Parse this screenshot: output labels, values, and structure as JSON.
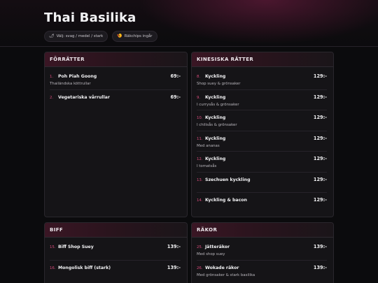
{
  "header": {
    "title": "Thai Basilika",
    "chips": [
      {
        "icon": "🌶",
        "icon_name": "chili-icon",
        "label": "Välj: svag / medel / stark"
      },
      {
        "icon": "🍤",
        "icon_name": "shrimp-chips-icon",
        "label": "Räkchips ingår"
      }
    ]
  },
  "colors": {
    "accent": "#d94b7c",
    "background": "#0b0b0d",
    "card": "#151417"
  },
  "sections": [
    {
      "title": "FÖRRÄTTER",
      "items": [
        {
          "num": "1.",
          "name": "Poh Piah Goong",
          "price": "69:-",
          "desc": "Thailändska köttrullar"
        },
        {
          "num": "2.",
          "name": "Vegetariska vårrullar",
          "price": "69:-",
          "desc": ""
        }
      ]
    },
    {
      "title": "KINESISKA RÄTTER",
      "items": [
        {
          "num": "8.",
          "name": "Kyckling",
          "price": "129:-",
          "desc": "Shop suey & grönsaker"
        },
        {
          "num": "9.",
          "name": "Kyckling",
          "price": "129:-",
          "desc": "I currysås & grönsaker"
        },
        {
          "num": "10.",
          "name": "Kyckling",
          "price": "129:-",
          "desc": "I chilisås & grönsaker"
        },
        {
          "num": "11.",
          "name": "Kyckling",
          "price": "129:-",
          "desc": "Med ananas"
        },
        {
          "num": "12.",
          "name": "Kyckling",
          "price": "129:-",
          "desc": "I tomatsås"
        },
        {
          "num": "13.",
          "name": "Szechuen kyckling",
          "price": "129:-",
          "desc": ""
        },
        {
          "num": "14.",
          "name": "Kyckling & bacon",
          "price": "129:-",
          "desc": ""
        }
      ]
    },
    {
      "title": "BIFF",
      "items": [
        {
          "num": "15.",
          "name": "Biff Shop Suey",
          "price": "139:-",
          "desc": ""
        },
        {
          "num": "16.",
          "name": "Mongolisk biff (stark)",
          "price": "139:-",
          "desc": ""
        }
      ]
    },
    {
      "title": "RÄKOR",
      "items": [
        {
          "num": "25.",
          "name": "Jätteräkor",
          "price": "139:-",
          "desc": "Med shop suey"
        },
        {
          "num": "26.",
          "name": "Wokade räkor",
          "price": "139:-",
          "desc": "Med grönsaker & stark basilika"
        }
      ]
    }
  ]
}
